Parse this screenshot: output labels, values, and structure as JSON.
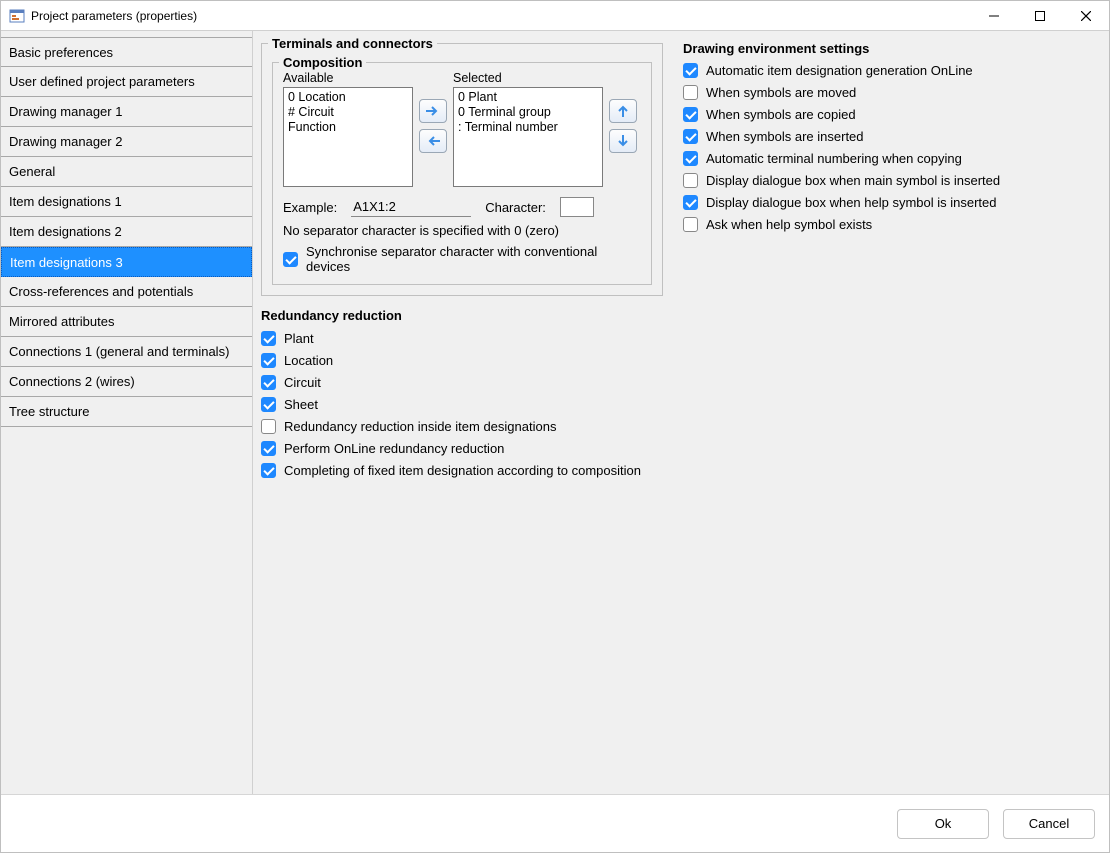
{
  "window": {
    "title": "Project parameters (properties)"
  },
  "sidebar": {
    "items": [
      "Basic preferences",
      "User defined project parameters",
      "Drawing manager 1",
      "Drawing manager 2",
      "General",
      "Item designations 1",
      "Item designations 2",
      "Item designations 3",
      "Cross-references and potentials",
      "Mirrored attributes",
      "Connections 1 (general and terminals)",
      "Connections 2 (wires)",
      "Tree structure"
    ],
    "selected_index": 7
  },
  "terminals": {
    "heading": "Terminals and connectors",
    "composition": {
      "heading": "Composition",
      "available_label": "Available",
      "selected_label": "Selected",
      "available": [
        "0 Location",
        "# Circuit",
        "  Function"
      ],
      "selected": [
        "0 Plant",
        "0 Terminal group",
        ": Terminal number"
      ],
      "example_label": "Example:",
      "example_value": "A1X1:2",
      "character_label": "Character:",
      "character_value": "",
      "hint": "No separator character is specified with 0 (zero)",
      "sync_label": "Synchronise separator character with conventional devices",
      "sync_checked": true
    }
  },
  "drawing_env": {
    "heading": "Drawing environment settings",
    "options": [
      {
        "label": "Automatic item designation generation OnLine",
        "checked": true
      },
      {
        "label": "When symbols are moved",
        "checked": false
      },
      {
        "label": "When symbols are copied",
        "checked": true
      },
      {
        "label": "When symbols are inserted",
        "checked": true
      },
      {
        "label": "Automatic terminal numbering when copying",
        "checked": true
      },
      {
        "label": "Display dialogue box when main symbol is inserted",
        "checked": false
      },
      {
        "label": "Display dialogue box when help symbol is inserted",
        "checked": true
      },
      {
        "label": "Ask when help symbol exists",
        "checked": false
      }
    ]
  },
  "redundancy": {
    "heading": "Redundancy reduction",
    "options": [
      {
        "label": "Plant",
        "checked": true
      },
      {
        "label": "Location",
        "checked": true
      },
      {
        "label": "Circuit",
        "checked": true
      },
      {
        "label": "Sheet",
        "checked": true
      },
      {
        "label": "Redundancy reduction inside item designations",
        "checked": false
      },
      {
        "label": "Perform OnLine redundancy reduction",
        "checked": true
      },
      {
        "label": "Completing of fixed item designation according to composition",
        "checked": true
      }
    ]
  },
  "footer": {
    "ok": "Ok",
    "cancel": "Cancel"
  }
}
